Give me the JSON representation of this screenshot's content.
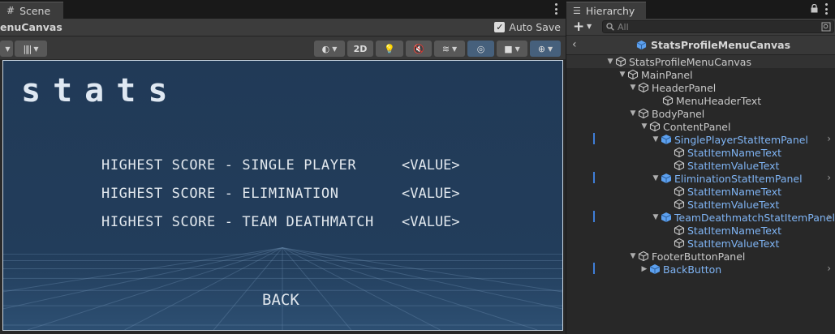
{
  "scene": {
    "tab_label": "Scene",
    "canvas_name": "enuCanvas",
    "auto_save_label": "Auto Save",
    "auto_save_checked": true,
    "toolbar": {
      "mode_2d_label": "2D"
    },
    "game": {
      "title": "stats",
      "rows": [
        {
          "label": "HIGHEST SCORE - SINGLE PLAYER",
          "value": "<VALUE>"
        },
        {
          "label": "HIGHEST SCORE - ELIMINATION",
          "value": "<VALUE>"
        },
        {
          "label": "HIGHEST SCORE - TEAM DEATHMATCH",
          "value": "<VALUE>"
        }
      ],
      "back_label": "BACK"
    }
  },
  "hierarchy": {
    "tab_label": "Hierarchy",
    "search_placeholder": "All",
    "context_name": "StatsProfileMenuCanvas",
    "items": [
      {
        "label": "StatsProfileMenuCanvas",
        "depth": 0,
        "fold": "open",
        "prefab": false
      },
      {
        "label": "MainPanel",
        "depth": 1,
        "fold": "open",
        "prefab": false
      },
      {
        "label": "HeaderPanel",
        "depth": 2,
        "fold": "open",
        "prefab": false
      },
      {
        "label": "MenuHeaderText",
        "depth": 3,
        "fold": "none",
        "prefab": false
      },
      {
        "label": "BodyPanel",
        "depth": 2,
        "fold": "open",
        "prefab": false
      },
      {
        "label": "ContentPanel",
        "depth": 3,
        "fold": "open",
        "prefab": false
      },
      {
        "label": "SinglePlayerStatItemPanel",
        "depth": 4,
        "fold": "open",
        "prefab": true
      },
      {
        "label": "StatItemNameText",
        "depth": 5,
        "fold": "none",
        "prefab": true
      },
      {
        "label": "StatItemValueText",
        "depth": 5,
        "fold": "none",
        "prefab": true
      },
      {
        "label": "EliminationStatItemPanel",
        "depth": 4,
        "fold": "open",
        "prefab": true
      },
      {
        "label": "StatItemNameText",
        "depth": 5,
        "fold": "none",
        "prefab": true
      },
      {
        "label": "StatItemValueText",
        "depth": 5,
        "fold": "none",
        "prefab": true
      },
      {
        "label": "TeamDeathmatchStatItemPanel",
        "depth": 4,
        "fold": "open",
        "prefab": true
      },
      {
        "label": "StatItemNameText",
        "depth": 5,
        "fold": "none",
        "prefab": true
      },
      {
        "label": "StatItemValueText",
        "depth": 5,
        "fold": "none",
        "prefab": true
      },
      {
        "label": "FooterButtonPanel",
        "depth": 2,
        "fold": "open",
        "prefab": false
      },
      {
        "label": "BackButton",
        "depth": 3,
        "fold": "closed",
        "prefab": true
      }
    ]
  },
  "colors": {
    "prefab_text": "#7fb4f4",
    "game_bg": "#223d5b",
    "accent_marker": "#3f7ed8"
  }
}
